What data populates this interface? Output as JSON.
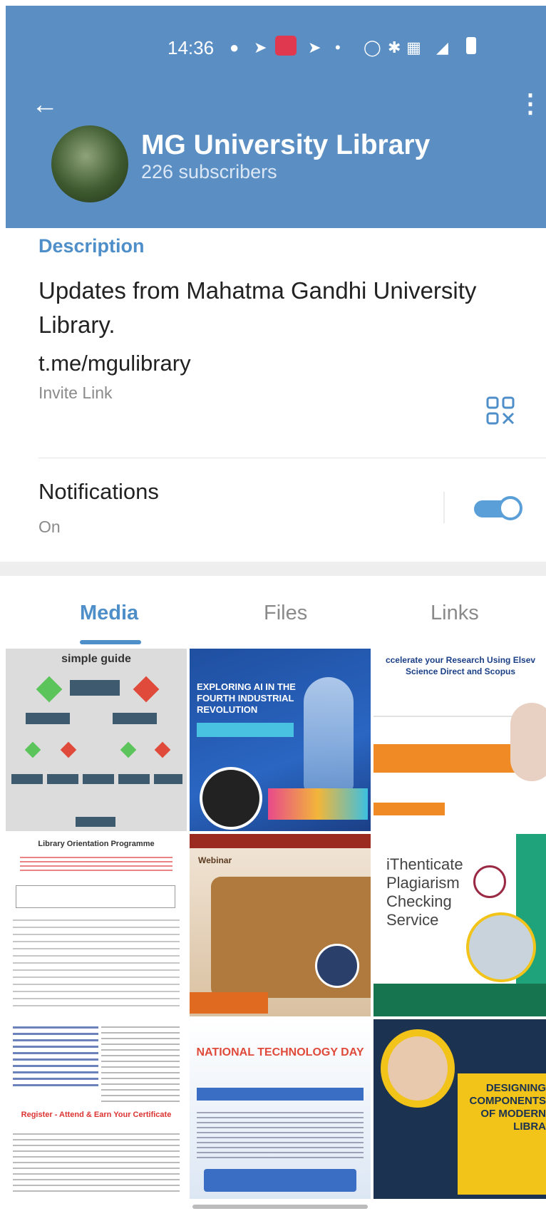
{
  "status_bar": {
    "time": "14:36"
  },
  "channel": {
    "title": "MG University Library",
    "subscribers": "226 subscribers"
  },
  "info": {
    "description_label": "Description",
    "description": "Updates from Mahatma Gandhi University Library.",
    "link": "t.me/mgulibrary",
    "link_sublabel": "Invite Link",
    "notifications_label": "Notifications",
    "notifications_state": "On"
  },
  "tabs": [
    {
      "label": "Media"
    },
    {
      "label": "Files"
    },
    {
      "label": "Links"
    }
  ],
  "media": [
    {
      "caption": "simple guide"
    },
    {
      "caption": "EXPLORING AI IN THE FOURTH INDUSTRIAL REVOLUTION"
    },
    {
      "caption": "ccelerate your Research Using Elsev Science Direct and Scopus"
    },
    {
      "caption": "Library Orientation Programme"
    },
    {
      "caption": "Webinar"
    },
    {
      "caption": "iThenticate Plagiarism Checking Service"
    },
    {
      "caption": "Register - Attend & Earn Your Certificate"
    },
    {
      "caption": "NATIONAL TECHNOLOGY DAY"
    },
    {
      "caption": "DESIGNING COMPONENTS OF MODERN LIBRA"
    }
  ],
  "colors": {
    "header": "#5b8fc4",
    "accent": "#4e8ec9"
  }
}
